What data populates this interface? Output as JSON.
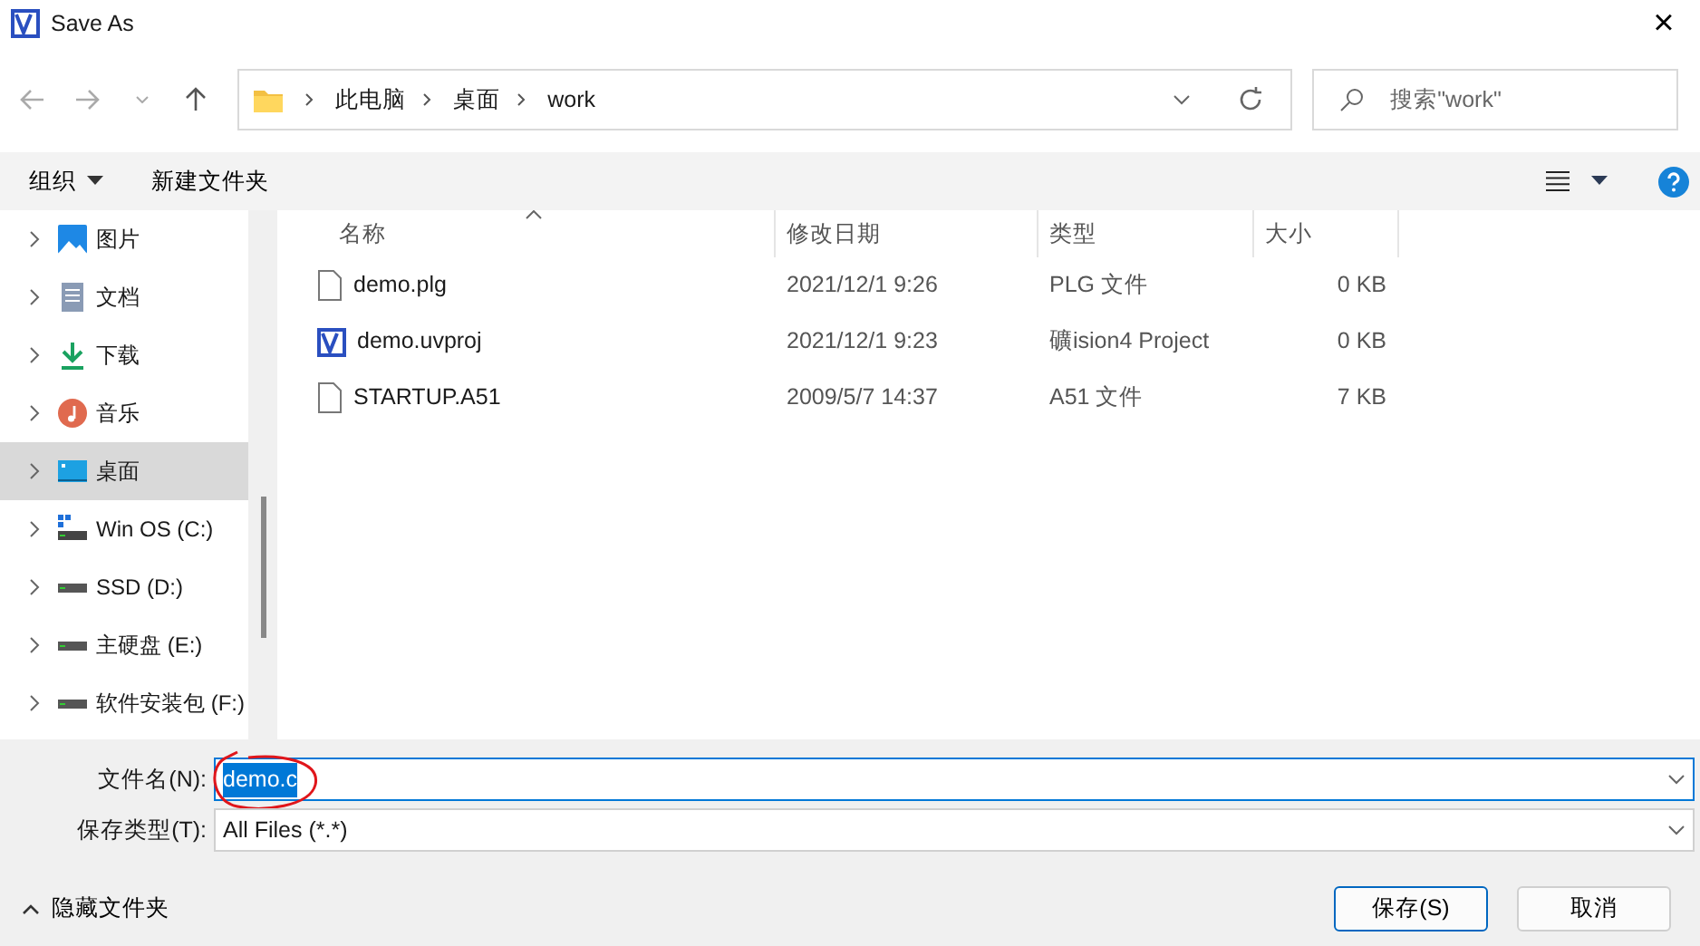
{
  "window": {
    "title": "Save As",
    "close": "×"
  },
  "address": {
    "path": [
      "此电脑",
      "桌面",
      "work"
    ]
  },
  "search": {
    "placeholder": "搜索\"work\""
  },
  "toolbar": {
    "organize": "组织",
    "new_folder": "新建文件夹"
  },
  "sidebar": {
    "items": [
      {
        "label": "图片",
        "kind": "pictures",
        "expanded": false,
        "selected": false
      },
      {
        "label": "文档",
        "kind": "documents",
        "expanded": false,
        "selected": false
      },
      {
        "label": "下载",
        "kind": "downloads",
        "expanded": false,
        "selected": false
      },
      {
        "label": "音乐",
        "kind": "music",
        "expanded": false,
        "selected": false
      },
      {
        "label": "桌面",
        "kind": "desktop",
        "expanded": false,
        "selected": true
      },
      {
        "label": "Win OS (C:)",
        "kind": "system-drive",
        "expanded": false,
        "selected": false
      },
      {
        "label": "SSD (D:)",
        "kind": "drive",
        "expanded": false,
        "selected": false
      },
      {
        "label": "主硬盘 (E:)",
        "kind": "drive",
        "expanded": false,
        "selected": false
      },
      {
        "label": "软件安装包 (F:)",
        "kind": "drive",
        "expanded": false,
        "selected": false
      }
    ]
  },
  "table": {
    "columns": [
      {
        "label": "名称",
        "sorted": true
      },
      {
        "label": "修改日期",
        "sorted": false
      },
      {
        "label": "类型",
        "sorted": false
      },
      {
        "label": "大小",
        "sorted": false
      }
    ],
    "rows": [
      {
        "kind": "file",
        "name": "demo.plg",
        "modified": "2021/12/1 9:26",
        "type": "PLG 文件",
        "size": "0 KB"
      },
      {
        "kind": "project",
        "name": "demo.uvproj",
        "modified": "2021/12/1 9:23",
        "type": "礦ision4 Project",
        "size": "0 KB"
      },
      {
        "kind": "file",
        "name": "STARTUP.A51",
        "modified": "2009/5/7 14:37",
        "type": "A51 文件",
        "size": "7 KB"
      }
    ]
  },
  "filename": {
    "label": "文件名(N):",
    "value": "demo.c",
    "selected": true
  },
  "filetype": {
    "label": "保存类型(T):",
    "value": "All Files (*.*)"
  },
  "footer": {
    "hide_folders": "隐藏文件夹",
    "save": "保存(S)",
    "cancel": "取消"
  }
}
